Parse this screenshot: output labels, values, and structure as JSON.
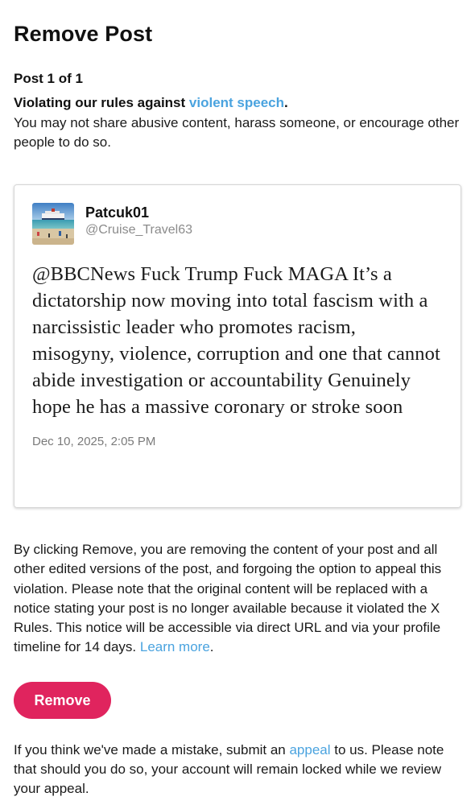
{
  "page_title": "Remove Post",
  "post_count": "Post 1 of 1",
  "violation": {
    "prefix": "Violating our rules against ",
    "link_text": "violent speech",
    "suffix": ".",
    "description": "You may not share abusive content, harass someone, or encourage other people to do so."
  },
  "post": {
    "author_name": "Patcuk01",
    "author_handle": "@Cruise_Travel63",
    "text": "@BBCNews Fuck Trump Fuck MAGA It’s a dictatorship now moving into total fascism with a narcissistic leader who promotes racism, misogyny, violence, corruption and one that cannot abide investigation or accountability Genuinely hope he has a massive coronary or stroke soon",
    "timestamp": "Dec 10, 2025, 2:05 PM"
  },
  "consequence": {
    "text": "By clicking Remove, you are removing the content of your post and all other edited versions of the post, and forgoing the option to appeal this violation. Please note that the original content will be replaced with a notice stating your post is no longer available because it violated the X Rules. This notice will be accessible via direct URL and via your profile timeline for 14 days. ",
    "learn_more": "Learn more",
    "suffix": "."
  },
  "remove_button_label": "Remove",
  "appeal": {
    "prefix": "If you think we've made a mistake, submit an ",
    "link_text": "appeal",
    "suffix": " to us. Please note that should you do so, your account will remain locked while we review your appeal."
  },
  "colors": {
    "accent_link": "#4aa3df",
    "remove_button": "#e0245e"
  },
  "icons": {
    "avatar": "cruise-ship-beach-avatar"
  }
}
